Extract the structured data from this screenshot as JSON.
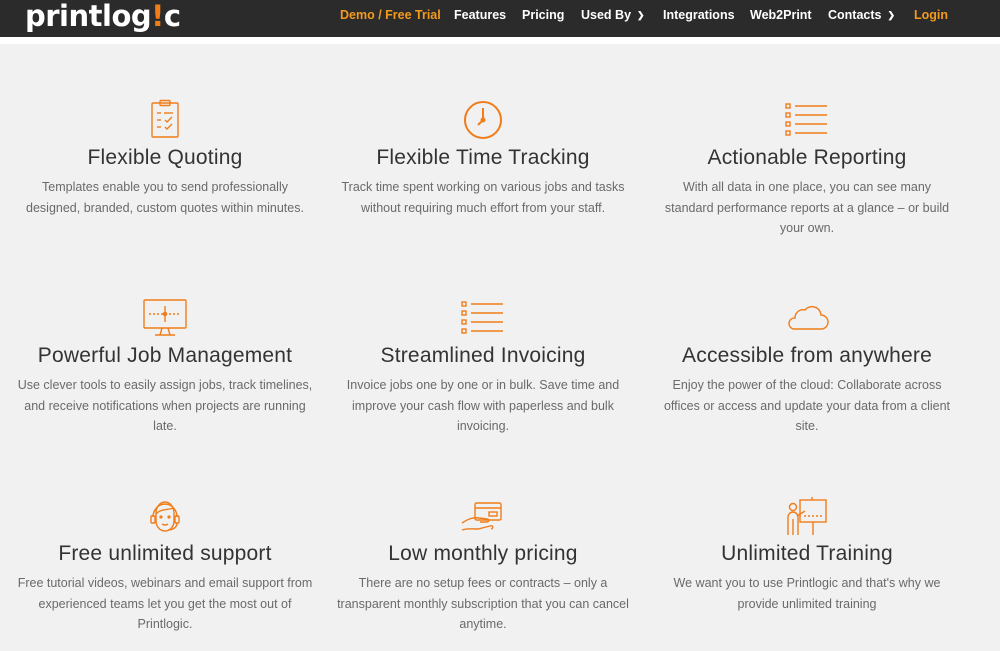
{
  "brand": {
    "logo_part1": "printlog",
    "logo_bang": "!",
    "logo_part2": "c",
    "accent_color": "#f07d1a",
    "nav_bg": "#2b2b2b"
  },
  "nav": {
    "demo": "Demo / Free Trial",
    "features": "Features",
    "pricing": "Pricing",
    "used_by": "Used By",
    "integrations": "Integrations",
    "web2print": "Web2Print",
    "contacts": "Contacts",
    "login": "Login"
  },
  "features": [
    {
      "title": "Flexible Quoting",
      "desc": "Templates enable you to send professionally designed, branded, custom quotes within minutes.",
      "icon": "clipboard-icon"
    },
    {
      "title": "Flexible Time Tracking",
      "desc": "Track time spent working on various jobs and tasks without requiring much effort from your staff.",
      "icon": "clock-icon"
    },
    {
      "title": "Actionable Reporting",
      "desc": "With all data in one place, you can see many standard performance reports at a glance – or build your own.",
      "icon": "list-icon"
    },
    {
      "title": "Powerful Job Management",
      "desc": "Use clever tools to easily assign jobs, track timelines, and receive notifications when projects are running late.",
      "icon": "monitor-icon"
    },
    {
      "title": "Streamlined Invoicing",
      "desc": "Invoice jobs one by one or in bulk. Save time and improve your cash flow with paperless and bulk invoicing.",
      "icon": "list-icon"
    },
    {
      "title": "Accessible from anywhere",
      "desc": "Enjoy the power of the cloud: Collaborate across offices or access and update your data from a client site.",
      "icon": "cloud-icon"
    },
    {
      "title": "Free unlimited support",
      "desc": "Free tutorial videos, webinars and email support from experienced teams let you get the most out of Printlogic.",
      "icon": "headset-person-icon"
    },
    {
      "title": "Low monthly pricing",
      "desc": "There are no setup fees or contracts – only a transparent monthly subscription that you can cancel anytime.",
      "icon": "card-in-hand-icon"
    },
    {
      "title": "Unlimited Training",
      "desc": "We want you to use Printlogic and that's why we provide unlimited training",
      "icon": "presenter-board-icon"
    }
  ]
}
